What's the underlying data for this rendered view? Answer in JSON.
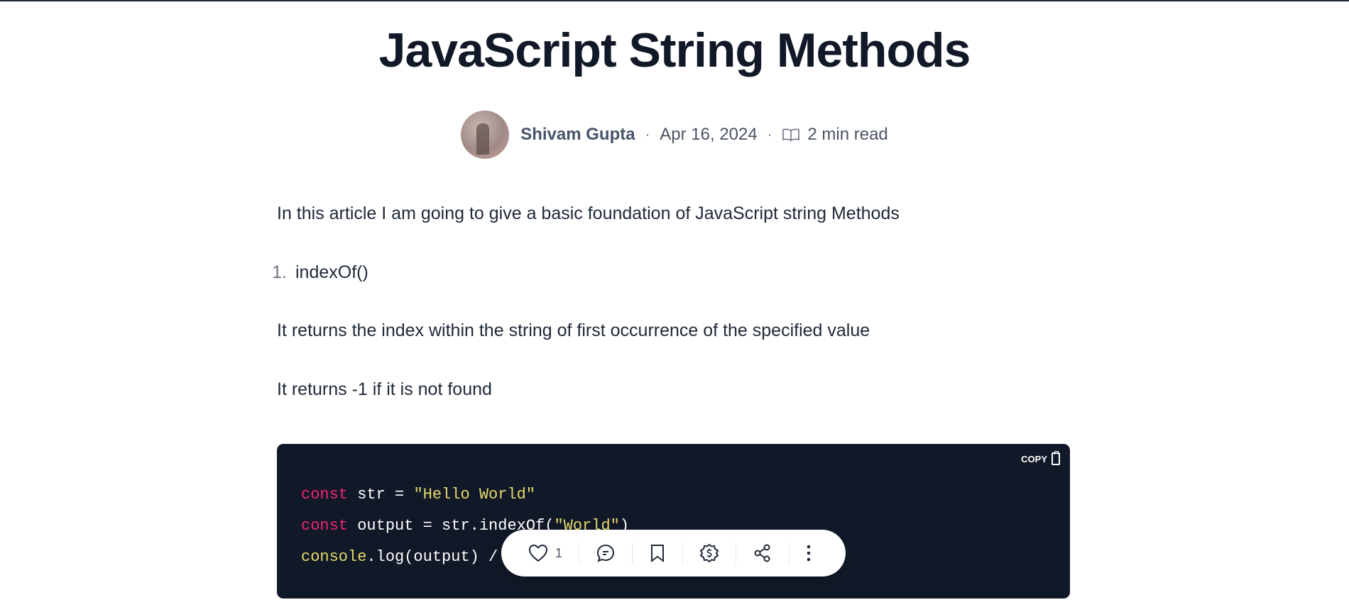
{
  "article": {
    "title": "JavaScript String Methods",
    "author": "Shivam Gupta",
    "date": "Apr 16, 2024",
    "read_time": "2 min read",
    "separator": "·",
    "intro": "In this article I am going to give a basic foundation of JavaScript string Methods",
    "list": [
      {
        "number": "1.",
        "text": "indexOf()"
      }
    ],
    "para1": "It returns the index within the string of first occurrence of the specified value",
    "para2": "It returns -1 if it is not found"
  },
  "code_block": {
    "copy_label": "COPY",
    "line1": {
      "kw": "const",
      "rest": " str = ",
      "str": "\"Hello World\""
    },
    "line2": {
      "kw": "const",
      "rest": " output = str.indexOf(",
      "str": "\"World\"",
      "end": ")"
    },
    "line3": {
      "fn": "console",
      "rest": ".log(output) /"
    },
    "colors": {
      "background": "#111827",
      "keyword": "#f0266f",
      "string": "#e6d96c"
    }
  },
  "action_bar": {
    "like_count": "1",
    "icons": [
      "heart-icon",
      "comment-icon",
      "bookmark-icon",
      "sponsor-dollar-icon",
      "share-icon",
      "more-vertical-icon"
    ]
  }
}
